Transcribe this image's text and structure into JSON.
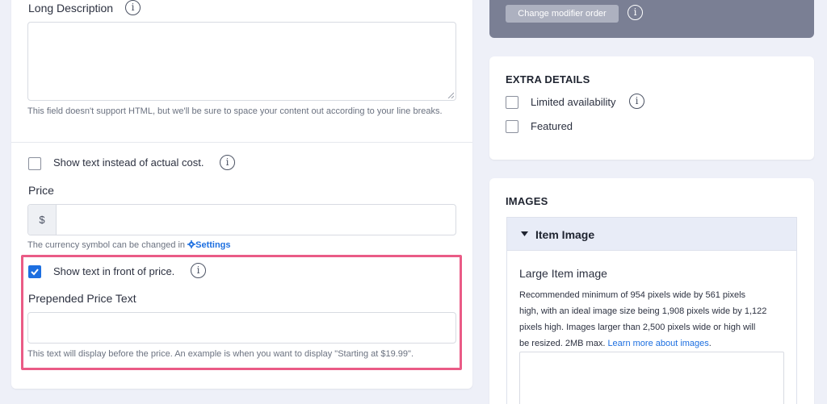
{
  "long_description": {
    "label": "Long Description",
    "value": "",
    "help": "This field doesn't support HTML, but we'll be sure to space your content out according to your line breaks."
  },
  "show_text_cost": {
    "label": "Show text instead of actual cost.",
    "checked": false
  },
  "price": {
    "label": "Price",
    "currency_symbol": "$",
    "value": "",
    "help_prefix": "The currency symbol can be changed in ",
    "settings_link": "Settings"
  },
  "show_text_front": {
    "label": "Show text in front of price.",
    "checked": true
  },
  "prepended_price": {
    "label": "Prepended Price Text",
    "value": "",
    "help": "This text will display before the price. An example is when you want to display \"Starting at $19.99\"."
  },
  "modifiers": {
    "button_label": "Change modifier order"
  },
  "extra_details": {
    "title": "EXTRA DETAILS",
    "limited_label": "Limited availability",
    "featured_label": "Featured"
  },
  "images": {
    "title": "IMAGES",
    "accordion_label": "Item Image",
    "large_label": "Large Item image",
    "desc_line1": "Recommended minimum of 954 pixels wide by 561 pixels",
    "desc_line2": "high, with an ideal image size being 1,908 pixels wide by 1,122",
    "desc_line3": "pixels high. Images larger than 2,500 pixels wide or high will",
    "desc_line4": "be resized. 2MB max. ",
    "learn_more": "Learn more about images",
    "learn_more_suffix": "."
  },
  "colors": {
    "accent": "#1d6fe0",
    "highlight": "#ea5b86"
  },
  "icons": {
    "info": "info-icon",
    "settings": "gear-icon",
    "accordion": "caret-down-icon"
  }
}
